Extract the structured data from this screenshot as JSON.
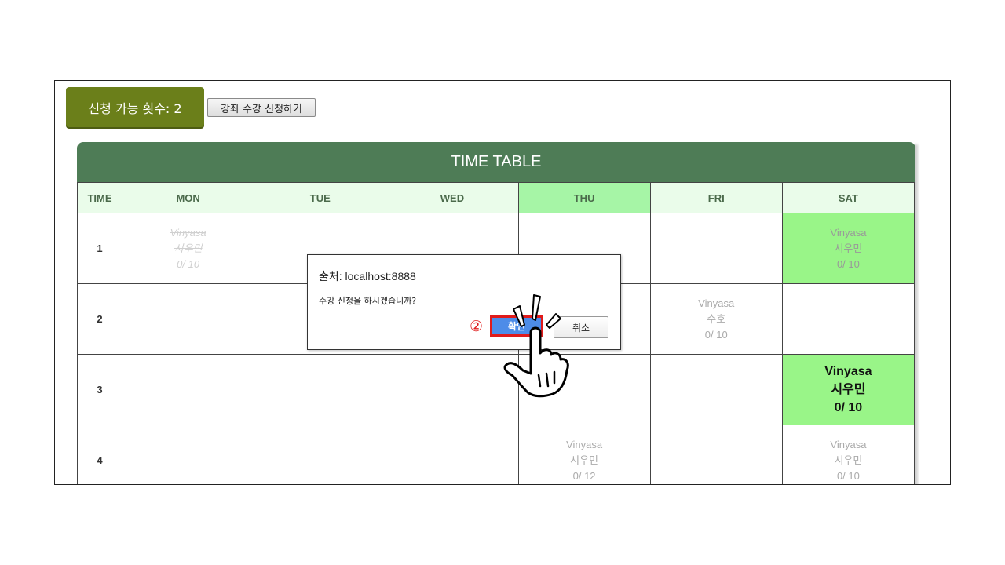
{
  "header": {
    "apply_count_label": "신청 가능 횟수: 2",
    "enroll_button_label": "강좌 수강 신청하기"
  },
  "timetable": {
    "title": "TIME TABLE",
    "columns": [
      "TIME",
      "MON",
      "TUE",
      "WED",
      "THU",
      "FRI",
      "SAT"
    ],
    "active_day": "THU",
    "rows": [
      {
        "time": "1"
      },
      {
        "time": "2"
      },
      {
        "time": "3"
      },
      {
        "time": "4"
      }
    ],
    "slots": {
      "mon_1": {
        "name": "Vinyasa",
        "teacher": "시우민",
        "count": "0/ 10",
        "status": "cancelled"
      },
      "sat_1": {
        "name": "Vinyasa",
        "teacher": "시우민",
        "count": "0/ 10",
        "status": "highlighted"
      },
      "fri_2": {
        "name": "Vinyasa",
        "teacher": "수호",
        "count": "0/ 10",
        "status": "normal"
      },
      "sat_3": {
        "name": "Vinyasa",
        "teacher": "시우민",
        "count": "0/ 10",
        "status": "selected"
      },
      "thu_4": {
        "name": "Vinyasa",
        "teacher": "시우민",
        "count": "0/ 12",
        "status": "normal"
      },
      "sat_4": {
        "name": "Vinyasa",
        "teacher": "시우민",
        "count": "0/ 10",
        "status": "normal"
      }
    }
  },
  "dialog": {
    "title": "출처: localhost:8888",
    "message": "수강 신청을 하시겠습니까?",
    "step_marker": "②",
    "ok_label": "확인",
    "cancel_label": "취소"
  },
  "colors": {
    "badge": "#6b7f1a",
    "table_header": "#4e7c56",
    "day_header": "#eafcea",
    "active_day": "#a6f5a6",
    "highlight_cell": "#99f588",
    "ok_button": "#4d8ce8",
    "marker_red": "#e01b1b"
  },
  "icons": {
    "cursor": "pointing-hand-icon"
  }
}
